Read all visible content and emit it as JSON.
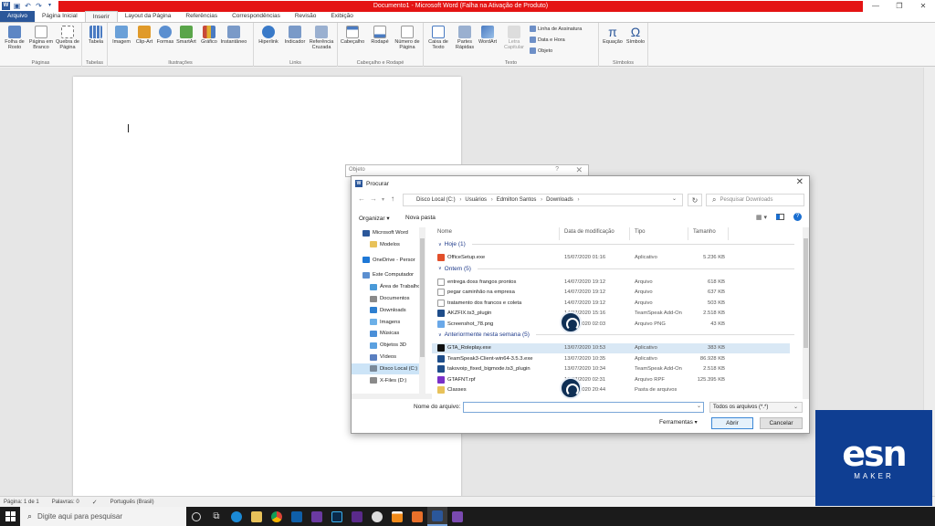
{
  "window": {
    "title": "Documento1 - Microsoft Word (Falha na Ativação de Produto)",
    "controls": [
      "—",
      "❐",
      "✕"
    ]
  },
  "ribbon": {
    "tabs": [
      "Arquivo",
      "Página Inicial",
      "Inserir",
      "Layout da Página",
      "Referências",
      "Correspondências",
      "Revisão",
      "Exibição"
    ],
    "active_tab": "Inserir",
    "groups": [
      {
        "label": "Páginas",
        "buttons": [
          "Folha de Rosto",
          "Página em Branco",
          "Quebra de Página"
        ]
      },
      {
        "label": "Tabelas",
        "buttons": [
          "Tabela"
        ]
      },
      {
        "label": "Ilustrações",
        "buttons": [
          "Imagem",
          "Clip-Art",
          "Formas",
          "SmartArt",
          "Gráfico",
          "Instantâneo"
        ]
      },
      {
        "label": "Links",
        "buttons": [
          "Hiperlink",
          "Indicador",
          "Referência Cruzada"
        ]
      },
      {
        "label": "Cabeçalho e Rodapé",
        "buttons": [
          "Cabeçalho",
          "Rodapé",
          "Número de Página"
        ]
      },
      {
        "label": "Texto",
        "buttons": [
          "Caixa de Texto",
          "Partes Rápidas",
          "WordArt",
          "Letra Capitular"
        ],
        "small": [
          "Linha de Assinatura",
          "Data e Hora",
          "Objeto"
        ]
      },
      {
        "label": "Símbolos",
        "buttons": [
          "Equação",
          "Símbolo"
        ]
      }
    ]
  },
  "status_bar": {
    "page": "Página: 1 de 1",
    "words": "Palavras: 0",
    "language": "Português (Brasil)"
  },
  "taskbar": {
    "search_placeholder": "Digite aqui para pesquisar"
  },
  "object_dialog": {
    "title": "Objeto",
    "help": "?",
    "close": "✕"
  },
  "open_dialog": {
    "title": "Procurar",
    "breadcrumb": [
      "Disco Local (C:)",
      "Usuários",
      "Edmilton Santos",
      "Downloads"
    ],
    "search_placeholder": "Pesquisar Downloads",
    "organize": "Organizar ▾",
    "new_folder": "Nova pasta",
    "nav_items": [
      {
        "label": "Microsoft Word",
        "color": "#2b579a"
      },
      {
        "label": "Modelos",
        "color": "#e8c25a"
      },
      {
        "label": "OneDrive - Persor",
        "color": "#1e78d6"
      },
      {
        "label": "Este Computador",
        "color": "#5b8fd0"
      },
      {
        "label": "Área de Trabalho",
        "color": "#4a9ad8"
      },
      {
        "label": "Documentos",
        "color": "#8a8a8a"
      },
      {
        "label": "Downloads",
        "color": "#2d7fd0"
      },
      {
        "label": "Imagens",
        "color": "#6cb0e8"
      },
      {
        "label": "Músicas",
        "color": "#4a8fd8"
      },
      {
        "label": "Objetos 3D",
        "color": "#5aa0e0"
      },
      {
        "label": "Vídeos",
        "color": "#5a7fc0"
      },
      {
        "label": "Disco Local (C:)",
        "color": "#7a8a9a",
        "selected": true
      },
      {
        "label": "X-Files (D:)",
        "color": "#8a8a8a"
      }
    ],
    "columns": [
      "Nome",
      "Data de modificação",
      "Tipo",
      "Tamanho"
    ],
    "groups": [
      {
        "label": "Hoje (1)",
        "rows": [
          {
            "name": "OfficeSetup.exe",
            "date": "15/07/2020 01:16",
            "type": "Aplicativo",
            "size": "5.236 KB",
            "color": "#e2502b"
          }
        ]
      },
      {
        "label": "Ontem (5)",
        "rows": [
          {
            "name": "entrega doss frangos prontos",
            "date": "14/07/2020 19:12",
            "type": "Arquivo",
            "size": "618 KB",
            "color": "#ffffff"
          },
          {
            "name": "pegar caminhão na empresa",
            "date": "14/07/2020 19:12",
            "type": "Arquivo",
            "size": "637 KB",
            "color": "#ffffff"
          },
          {
            "name": "tratamento dos francos e coleta",
            "date": "14/07/2020 19:12",
            "type": "Arquivo",
            "size": "503 KB",
            "color": "#ffffff"
          },
          {
            "name": "AKZFIX.ts3_plugin",
            "date": "14/07/2020 15:16",
            "type": "TeamSpeak Add-On",
            "size": "2.518 KB",
            "color": "#1e4d8a"
          },
          {
            "name": "Screenshot_78.png",
            "date": "14/07/2020 02:03",
            "type": "Arquivo PNG",
            "size": "43 KB",
            "color": "#6aa8e8"
          }
        ]
      },
      {
        "label": "Anteriormente nesta semana (5)",
        "rows": [
          {
            "name": "GTA_Roleplay.exe",
            "date": "13/07/2020 10:53",
            "type": "Aplicativo",
            "size": "383 KB",
            "color": "#111111",
            "selected": true
          },
          {
            "name": "TeamSpeak3-Client-win64-3.5.3.exe",
            "date": "13/07/2020 10:35",
            "type": "Aplicativo",
            "size": "86.928 KB",
            "color": "#1e4d8a"
          },
          {
            "name": "takovoip_fixed_bigmode.ts3_plugin",
            "date": "13/07/2020 10:34",
            "type": "TeamSpeak Add-On",
            "size": "2.518 KB",
            "color": "#1e4d8a"
          },
          {
            "name": "GTAFNT.rpf",
            "date": "12/07/2020 02:31",
            "type": "Arquivo RPF",
            "size": "125.395 KB",
            "color": "#7a30c8"
          },
          {
            "name": "Classes",
            "date": "12/07/2020 20:44",
            "type": "Pasta de arquivos",
            "size": "",
            "color": "#e8c25a"
          }
        ]
      }
    ],
    "file_name_label": "Nome do arquivo:",
    "file_name_value": "",
    "file_type": "Todos os arquivos (*.*)",
    "tools": "Ferramentas",
    "open_button": "Abrir",
    "cancel_button": "Cancelar"
  },
  "watermark": {
    "brand": "esn",
    "sub": "MAKER"
  },
  "colors": {
    "word_blue": "#2b579a",
    "title_red": "#e41414",
    "esn_blue": "#0f3e92"
  }
}
